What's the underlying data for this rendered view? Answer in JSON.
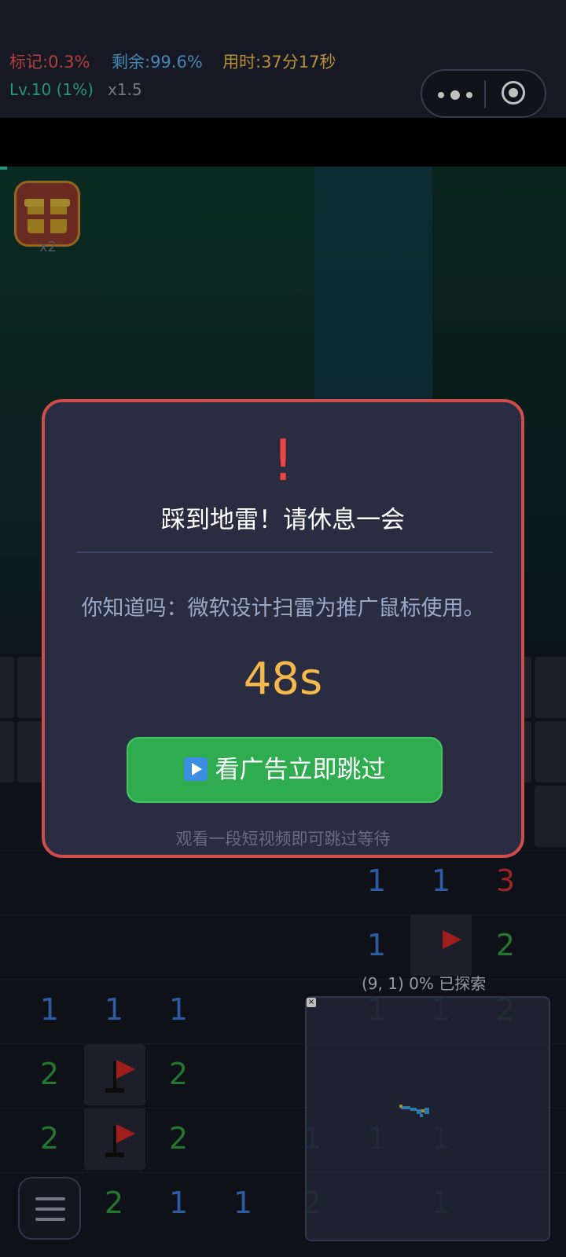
{
  "status": {
    "flag_label": "标记:0.3%",
    "remain_label": "剩余:99.6%",
    "time_label": "用时:37分17秒",
    "level_label": "Lv.10 (1%)",
    "multiplier_label": "x1.5"
  },
  "gift": {
    "count_label": "x2"
  },
  "board": {
    "numbers": [
      "1",
      "1",
      "3",
      "1",
      "2",
      "1",
      "1",
      "1",
      "1",
      "1",
      "2",
      "2",
      "2",
      "2",
      "2",
      "1",
      "1",
      "1",
      "2",
      "1",
      "2",
      "1",
      "1"
    ]
  },
  "minimap": {
    "coords_label": "(9, 1)",
    "explored_label": "0% 已探索"
  },
  "dialog": {
    "alert_glyph": "!",
    "title": "踩到地雷！请休息一会",
    "tip": "你知道吗：微软设计扫雷为推广鼠标使用。",
    "countdown": "48s",
    "skip_button_label": "看广告立即跳过",
    "hint": "观看一段短视频即可跳过等待"
  },
  "colors": {
    "dialog_border": "#d04b4b",
    "countdown": "#f5b84a",
    "skip_button": "#2fac4f",
    "alert": "#ef4444"
  }
}
